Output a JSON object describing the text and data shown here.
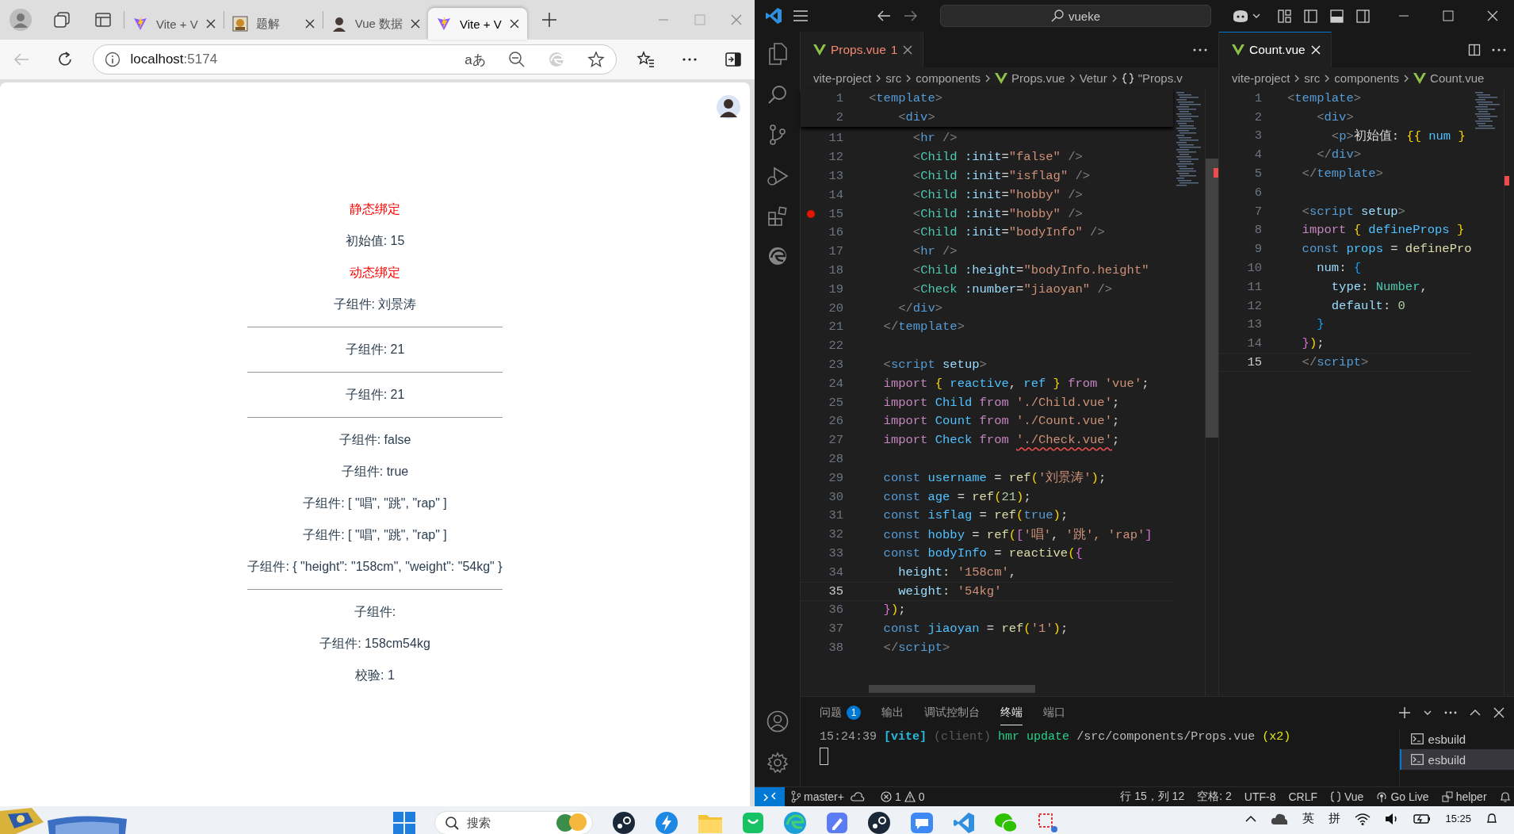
{
  "browser": {
    "tabs": [
      {
        "title": "Vite + V",
        "selected": false
      },
      {
        "title": "题解",
        "selected": false
      },
      {
        "title": "Vue 数据",
        "selected": false
      },
      {
        "title": "Vite + V",
        "selected": true
      }
    ],
    "address": {
      "host": "localhost",
      "port": ":5174"
    },
    "read_aloud": "aあ",
    "page": [
      {
        "kind": "text",
        "text": "静态绑定",
        "color": "#ff0000"
      },
      {
        "kind": "text",
        "text": "初始值: 15",
        "color": "#2c3e50"
      },
      {
        "kind": "text",
        "text": "动态绑定",
        "color": "#ff0000"
      },
      {
        "kind": "text",
        "text": "子组件: 刘景涛",
        "color": "#2c3e50"
      },
      {
        "kind": "rule"
      },
      {
        "kind": "text",
        "text": "子组件: 21",
        "color": "#2c3e50"
      },
      {
        "kind": "rule"
      },
      {
        "kind": "text",
        "text": "子组件: 21",
        "color": "#2c3e50"
      },
      {
        "kind": "rule"
      },
      {
        "kind": "text",
        "text": "子组件: false",
        "color": "#2c3e50"
      },
      {
        "kind": "text",
        "text": "子组件: true",
        "color": "#2c3e50"
      },
      {
        "kind": "text",
        "text": "子组件: [ \"唱\", \"跳\", \"rap\" ]",
        "color": "#2c3e50"
      },
      {
        "kind": "text",
        "text": "子组件: [ \"唱\", \"跳\", \"rap\" ]",
        "color": "#2c3e50"
      },
      {
        "kind": "text",
        "text": "子组件: { \"height\": \"158cm\", \"weight\": \"54kg\" }",
        "color": "#2c3e50"
      },
      {
        "kind": "rule"
      },
      {
        "kind": "text",
        "text": "子组件:",
        "color": "#2c3e50"
      },
      {
        "kind": "text",
        "text": "子组件: 158cm54kg",
        "color": "#2c3e50"
      },
      {
        "kind": "text",
        "text": "校验: 1",
        "color": "#2c3e50"
      }
    ]
  },
  "vscode": {
    "search": "vueke",
    "editors": [
      {
        "focused": false,
        "tabs": [
          {
            "label": "Props.vue",
            "badge": "1",
            "error": true,
            "selected": true
          }
        ],
        "breadcrumbs": [
          {
            "text": "vite-project",
            "kind": "folder"
          },
          {
            "text": "src",
            "kind": "folder"
          },
          {
            "text": "components",
            "kind": "folder"
          },
          {
            "text": "Props.vue",
            "kind": "vue"
          },
          {
            "text": "Vetur",
            "kind": "folder"
          },
          {
            "text": "\"Props.v",
            "kind": "symbol"
          }
        ],
        "sticky": [
          {
            "n": "1",
            "code": [
              {
                "color": "#808080",
                "text": "<"
              },
              {
                "color": "#569cd6",
                "text": "template"
              },
              {
                "color": "#808080",
                "text": ">"
              }
            ]
          },
          {
            "n": "2",
            "code": [
              {
                "color": "#808080",
                "text": "    <"
              },
              {
                "color": "#569cd6",
                "text": "div"
              },
              {
                "color": "#808080",
                "text": ">"
              }
            ]
          }
        ],
        "lines": [
          {
            "n": "11",
            "code": [
              {
                "color": "#808080",
                "text": "      <"
              },
              {
                "color": "#569cd6",
                "text": "hr"
              },
              {
                "color": "#808080",
                "text": " />"
              }
            ]
          },
          {
            "n": "12",
            "code": [
              {
                "color": "#808080",
                "text": "      <"
              },
              {
                "color": "#4ec9b0",
                "text": "Child"
              },
              {
                "color": "#9cdcfe",
                "text": " :init"
              },
              {
                "color": "#d4d4d4",
                "text": "="
              },
              {
                "color": "#ce9178",
                "text": "\"false\""
              },
              {
                "color": "#808080",
                "text": " />"
              }
            ]
          },
          {
            "n": "13",
            "code": [
              {
                "color": "#808080",
                "text": "      <"
              },
              {
                "color": "#4ec9b0",
                "text": "Child"
              },
              {
                "color": "#9cdcfe",
                "text": " :init"
              },
              {
                "color": "#d4d4d4",
                "text": "="
              },
              {
                "color": "#ce9178",
                "text": "\"isflag\""
              },
              {
                "color": "#808080",
                "text": " />"
              }
            ]
          },
          {
            "n": "14",
            "code": [
              {
                "color": "#808080",
                "text": "      <"
              },
              {
                "color": "#4ec9b0",
                "text": "Child"
              },
              {
                "color": "#9cdcfe",
                "text": " :init"
              },
              {
                "color": "#d4d4d4",
                "text": "="
              },
              {
                "color": "#ce9178",
                "text": "\"hobby\""
              },
              {
                "color": "#808080",
                "text": " />"
              }
            ]
          },
          {
            "n": "15",
            "breakpoint": true,
            "code": [
              {
                "color": "#808080",
                "text": "      <"
              },
              {
                "color": "#4ec9b0",
                "text": "Child"
              },
              {
                "color": "#9cdcfe",
                "text": " :init"
              },
              {
                "color": "#d4d4d4",
                "text": "="
              },
              {
                "color": "#ce9178",
                "text": "\"hobby\""
              },
              {
                "color": "#808080",
                "text": " />"
              }
            ]
          },
          {
            "n": "16",
            "code": [
              {
                "color": "#808080",
                "text": "      <"
              },
              {
                "color": "#4ec9b0",
                "text": "Child"
              },
              {
                "color": "#9cdcfe",
                "text": " :init"
              },
              {
                "color": "#d4d4d4",
                "text": "="
              },
              {
                "color": "#ce9178",
                "text": "\"bodyInfo\""
              },
              {
                "color": "#808080",
                "text": " />"
              }
            ]
          },
          {
            "n": "17",
            "code": [
              {
                "color": "#808080",
                "text": "      <"
              },
              {
                "color": "#569cd6",
                "text": "hr"
              },
              {
                "color": "#808080",
                "text": " />"
              }
            ]
          },
          {
            "n": "18",
            "code": [
              {
                "color": "#808080",
                "text": "      <"
              },
              {
                "color": "#4ec9b0",
                "text": "Child"
              },
              {
                "color": "#9cdcfe",
                "text": " :height"
              },
              {
                "color": "#d4d4d4",
                "text": "="
              },
              {
                "color": "#ce9178",
                "text": "\"bodyInfo.height\""
              }
            ]
          },
          {
            "n": "19",
            "code": [
              {
                "color": "#808080",
                "text": "      <"
              },
              {
                "color": "#4ec9b0",
                "text": "Check"
              },
              {
                "color": "#9cdcfe",
                "text": " :number"
              },
              {
                "color": "#d4d4d4",
                "text": "="
              },
              {
                "color": "#ce9178",
                "text": "\"jiaoyan\""
              },
              {
                "color": "#808080",
                "text": " />"
              }
            ]
          },
          {
            "n": "20",
            "code": [
              {
                "color": "#808080",
                "text": "    </"
              },
              {
                "color": "#569cd6",
                "text": "div"
              },
              {
                "color": "#808080",
                "text": ">"
              }
            ]
          },
          {
            "n": "21",
            "code": [
              {
                "color": "#808080",
                "text": "  </"
              },
              {
                "color": "#569cd6",
                "text": "template"
              },
              {
                "color": "#808080",
                "text": ">"
              }
            ]
          },
          {
            "n": "22"
          },
          {
            "n": "23",
            "code": [
              {
                "color": "#808080",
                "text": "  <"
              },
              {
                "color": "#569cd6",
                "text": "script"
              },
              {
                "color": "#9cdcfe",
                "text": " setup"
              },
              {
                "color": "#808080",
                "text": ">"
              }
            ]
          },
          {
            "n": "24",
            "code": [
              {
                "color": "#c586c0",
                "text": "  import"
              },
              {
                "color": "#ffd700",
                "text": " {"
              },
              {
                "color": "#4fc1ff",
                "text": " reactive"
              },
              {
                "color": "#d4d4d4",
                "text": ","
              },
              {
                "color": "#4fc1ff",
                "text": " ref"
              },
              {
                "color": "#ffd700",
                "text": " }"
              },
              {
                "color": "#c586c0",
                "text": " from"
              },
              {
                "color": "#ce9178",
                "text": " 'vue'"
              },
              {
                "color": "#d4d4d4",
                "text": ";"
              }
            ]
          },
          {
            "n": "25",
            "code": [
              {
                "color": "#c586c0",
                "text": "  import"
              },
              {
                "color": "#4fc1ff",
                "text": " Child"
              },
              {
                "color": "#c586c0",
                "text": " from"
              },
              {
                "color": "#ce9178",
                "text": " './Child.vue'"
              },
              {
                "color": "#d4d4d4",
                "text": ";"
              }
            ]
          },
          {
            "n": "26",
            "code": [
              {
                "color": "#c586c0",
                "text": "  import"
              },
              {
                "color": "#4fc1ff",
                "text": " Count"
              },
              {
                "color": "#c586c0",
                "text": " from"
              },
              {
                "color": "#ce9178",
                "text": " './Count.vue'"
              },
              {
                "color": "#d4d4d4",
                "text": ";"
              }
            ]
          },
          {
            "n": "27",
            "code": [
              {
                "color": "#c586c0",
                "text": "  import"
              },
              {
                "color": "#4fc1ff",
                "text": " Check"
              },
              {
                "color": "#c586c0",
                "text": " from "
              },
              {
                "color": "#ce9178",
                "text": "'./Check.vue'",
                "squiggle": true
              },
              {
                "color": "#d4d4d4",
                "text": ";"
              }
            ]
          },
          {
            "n": "28"
          },
          {
            "n": "29",
            "code": [
              {
                "color": "#569cd6",
                "text": "  const"
              },
              {
                "color": "#4fc1ff",
                "text": " username"
              },
              {
                "color": "#d4d4d4",
                "text": " = "
              },
              {
                "color": "#dcdcaa",
                "text": "ref"
              },
              {
                "color": "#ffd700",
                "text": "("
              },
              {
                "color": "#ce9178",
                "text": "'刘景涛'"
              },
              {
                "color": "#ffd700",
                "text": ")"
              },
              {
                "color": "#d4d4d4",
                "text": ";"
              }
            ]
          },
          {
            "n": "30",
            "code": [
              {
                "color": "#569cd6",
                "text": "  const"
              },
              {
                "color": "#4fc1ff",
                "text": " age"
              },
              {
                "color": "#d4d4d4",
                "text": " = "
              },
              {
                "color": "#dcdcaa",
                "text": "ref"
              },
              {
                "color": "#ffd700",
                "text": "("
              },
              {
                "color": "#b5cea8",
                "text": "21"
              },
              {
                "color": "#ffd700",
                "text": ")"
              },
              {
                "color": "#d4d4d4",
                "text": ";"
              }
            ]
          },
          {
            "n": "31",
            "code": [
              {
                "color": "#569cd6",
                "text": "  const"
              },
              {
                "color": "#4fc1ff",
                "text": " isflag"
              },
              {
                "color": "#d4d4d4",
                "text": " = "
              },
              {
                "color": "#dcdcaa",
                "text": "ref"
              },
              {
                "color": "#ffd700",
                "text": "("
              },
              {
                "color": "#569cd6",
                "text": "true"
              },
              {
                "color": "#ffd700",
                "text": ")"
              },
              {
                "color": "#d4d4d4",
                "text": ";"
              }
            ]
          },
          {
            "n": "32",
            "code": [
              {
                "color": "#569cd6",
                "text": "  const"
              },
              {
                "color": "#4fc1ff",
                "text": " hobby"
              },
              {
                "color": "#d4d4d4",
                "text": " = "
              },
              {
                "color": "#dcdcaa",
                "text": "ref"
              },
              {
                "color": "#ffd700",
                "text": "("
              },
              {
                "color": "#da70d6",
                "text": "["
              },
              {
                "color": "#ce9178",
                "text": "'唱'"
              },
              {
                "color": "#d4d4d4",
                "text": ", "
              },
              {
                "color": "#ce9178",
                "text": "'跳',"
              },
              {
                "color": "#ce9178",
                "text": " 'rap'"
              },
              {
                "color": "#da70d6",
                "text": "]"
              }
            ]
          },
          {
            "n": "33",
            "code": [
              {
                "color": "#569cd6",
                "text": "  const"
              },
              {
                "color": "#4fc1ff",
                "text": " bodyInfo"
              },
              {
                "color": "#d4d4d4",
                "text": " = "
              },
              {
                "color": "#dcdcaa",
                "text": "reactive"
              },
              {
                "color": "#ffd700",
                "text": "("
              },
              {
                "color": "#da70d6",
                "text": "{"
              }
            ]
          },
          {
            "n": "34",
            "code": [
              {
                "color": "#9cdcfe",
                "text": "    height"
              },
              {
                "color": "#d4d4d4",
                "text": ": "
              },
              {
                "color": "#ce9178",
                "text": "'158cm'"
              },
              {
                "color": "#d4d4d4",
                "text": ","
              }
            ]
          },
          {
            "n": "35",
            "current": true,
            "code": [
              {
                "color": "#9cdcfe",
                "text": "    weight"
              },
              {
                "color": "#d4d4d4",
                "text": ": "
              },
              {
                "color": "#ce9178",
                "text": "'54kg'"
              }
            ]
          },
          {
            "n": "36",
            "code": [
              {
                "color": "#da70d6",
                "text": "  }"
              },
              {
                "color": "#ffd700",
                "text": ")"
              },
              {
                "color": "#d4d4d4",
                "text": ";"
              }
            ]
          },
          {
            "n": "37",
            "code": [
              {
                "color": "#569cd6",
                "text": "  const"
              },
              {
                "color": "#4fc1ff",
                "text": " jiaoyan"
              },
              {
                "color": "#d4d4d4",
                "text": " = "
              },
              {
                "color": "#dcdcaa",
                "text": "ref"
              },
              {
                "color": "#ffd700",
                "text": "("
              },
              {
                "color": "#ce9178",
                "text": "'1'"
              },
              {
                "color": "#ffd700",
                "text": ")"
              },
              {
                "color": "#d4d4d4",
                "text": ";"
              }
            ]
          },
          {
            "n": "38",
            "code": [
              {
                "color": "#808080",
                "text": "  </"
              },
              {
                "color": "#569cd6",
                "text": "script"
              },
              {
                "color": "#808080",
                "text": ">"
              }
            ]
          }
        ]
      },
      {
        "focused": true,
        "tabs": [
          {
            "label": "Count.vue",
            "error": false,
            "selected": true
          }
        ],
        "breadcrumbs": [
          {
            "text": "vite-project",
            "kind": "folder"
          },
          {
            "text": "src",
            "kind": "folder"
          },
          {
            "text": "components",
            "kind": "folder"
          },
          {
            "text": "Count.vue",
            "kind": "vue"
          }
        ],
        "lines": [
          {
            "n": "1",
            "code": [
              {
                "color": "#808080",
                "text": "<"
              },
              {
                "color": "#569cd6",
                "text": "template"
              },
              {
                "color": "#808080",
                "text": ">"
              }
            ]
          },
          {
            "n": "2",
            "code": [
              {
                "color": "#808080",
                "text": "    <"
              },
              {
                "color": "#569cd6",
                "text": "div"
              },
              {
                "color": "#808080",
                "text": ">"
              }
            ]
          },
          {
            "n": "3",
            "code": [
              {
                "color": "#808080",
                "text": "      <"
              },
              {
                "color": "#569cd6",
                "text": "p"
              },
              {
                "color": "#808080",
                "text": ">"
              },
              {
                "color": "#d4d4d4",
                "text": "初始值: "
              },
              {
                "color": "#ffd700",
                "text": "{{"
              },
              {
                "color": "#4fc1ff",
                "text": " num"
              },
              {
                "color": "#ffd700",
                "text": " }"
              }
            ]
          },
          {
            "n": "4",
            "code": [
              {
                "color": "#808080",
                "text": "    </"
              },
              {
                "color": "#569cd6",
                "text": "div"
              },
              {
                "color": "#808080",
                "text": ">"
              }
            ]
          },
          {
            "n": "5",
            "code": [
              {
                "color": "#808080",
                "text": "  </"
              },
              {
                "color": "#569cd6",
                "text": "template"
              },
              {
                "color": "#808080",
                "text": ">"
              }
            ]
          },
          {
            "n": "6"
          },
          {
            "n": "7",
            "code": [
              {
                "color": "#808080",
                "text": "  <"
              },
              {
                "color": "#569cd6",
                "text": "script"
              },
              {
                "color": "#9cdcfe",
                "text": " setup"
              },
              {
                "color": "#808080",
                "text": ">"
              }
            ]
          },
          {
            "n": "8",
            "code": [
              {
                "color": "#c586c0",
                "text": "  import"
              },
              {
                "color": "#ffd700",
                "text": " {"
              },
              {
                "color": "#4fc1ff",
                "text": " defineProps"
              },
              {
                "color": "#ffd700",
                "text": " }"
              }
            ]
          },
          {
            "n": "9",
            "code": [
              {
                "color": "#569cd6",
                "text": "  const"
              },
              {
                "color": "#4fc1ff",
                "text": " props"
              },
              {
                "color": "#d4d4d4",
                "text": " = "
              },
              {
                "color": "#dcdcaa",
                "text": "definePro"
              }
            ]
          },
          {
            "n": "10",
            "code": [
              {
                "color": "#9cdcfe",
                "text": "    num"
              },
              {
                "color": "#d4d4d4",
                "text": ": "
              },
              {
                "color": "#179fff",
                "text": "{"
              }
            ]
          },
          {
            "n": "11",
            "code": [
              {
                "color": "#9cdcfe",
                "text": "      type"
              },
              {
                "color": "#d4d4d4",
                "text": ": "
              },
              {
                "color": "#4ec9b0",
                "text": "Number"
              },
              {
                "color": "#d4d4d4",
                "text": ","
              }
            ]
          },
          {
            "n": "12",
            "code": [
              {
                "color": "#9cdcfe",
                "text": "      default"
              },
              {
                "color": "#d4d4d4",
                "text": ": "
              },
              {
                "color": "#b5cea8",
                "text": "0"
              }
            ]
          },
          {
            "n": "13",
            "code": [
              {
                "color": "#179fff",
                "text": "    }"
              }
            ]
          },
          {
            "n": "14",
            "code": [
              {
                "color": "#da70d6",
                "text": "  }"
              },
              {
                "color": "#ffd700",
                "text": ")"
              },
              {
                "color": "#d4d4d4",
                "text": ";"
              }
            ]
          },
          {
            "n": "15",
            "current": true,
            "code": [
              {
                "color": "#808080",
                "text": "  </"
              },
              {
                "color": "#569cd6",
                "text": "script"
              },
              {
                "color": "#808080",
                "text": ">"
              }
            ]
          }
        ]
      }
    ],
    "panel": {
      "tabs": [
        {
          "label": "问题",
          "badge": "1",
          "selected": false
        },
        {
          "label": "输出",
          "selected": false
        },
        {
          "label": "调试控制台",
          "selected": false
        },
        {
          "label": "终端",
          "selected": true
        },
        {
          "label": "端口",
          "selected": false
        }
      ],
      "terminal": [
        {
          "color": "#a0a0a0",
          "text": "15:24:39"
        },
        {
          "color": "#29b8db",
          "text": "[vite]"
        },
        {
          "color": "#5a5a5a",
          "text": "(client)"
        },
        {
          "color": "#23d18b",
          "text": "hmr update"
        },
        {
          "color": "#bbbbbb",
          "text": "/src/components/Props.vue"
        },
        {
          "color": "#e5e510",
          "text": "(x2)"
        }
      ],
      "terminals": [
        {
          "label": "esbuild",
          "selected": false
        },
        {
          "label": "esbuild",
          "selected": true
        }
      ]
    },
    "status": {
      "branch": "master+",
      "errors": "1",
      "warnings": "0",
      "position": "行 15，列 12",
      "spaces": "空格: 2",
      "encoding": "UTF-8",
      "eol": "CRLF",
      "language": "Vue",
      "golive": "Go Live",
      "account": "helper"
    }
  },
  "taskbar": {
    "search": "搜索",
    "ime": [
      "英",
      "拼"
    ],
    "time": "15:25"
  }
}
